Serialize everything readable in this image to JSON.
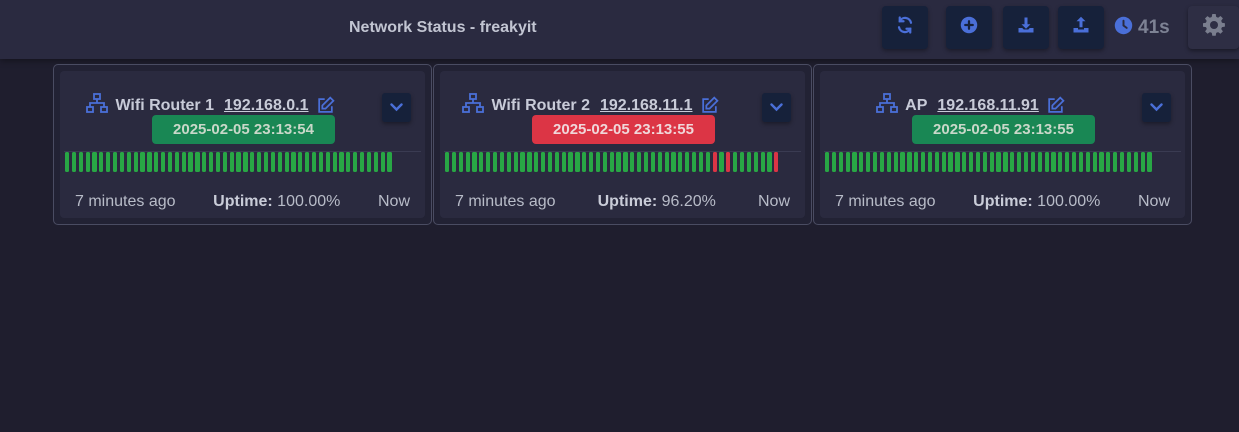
{
  "header": {
    "title": "Network Status - freakyit",
    "timer_value": "41s",
    "buttons": {
      "refresh_icon": "refresh-icon",
      "add_icon": "plus-circle-icon",
      "import_icon": "download-icon",
      "export_icon": "upload-icon",
      "timer_icon": "clock-icon",
      "settings_icon": "gear-icon"
    }
  },
  "colors": {
    "up": "#28a745",
    "down": "#dc3545",
    "accent": "#4a6fd8",
    "badge_up": "#198754",
    "badge_down": "#dc3545"
  },
  "devices": [
    {
      "name": "Wifi Router 1",
      "ip": "192.168.0.1",
      "last_check": "2025-02-05 23:13:54",
      "status": "up",
      "first_seen": "7 minutes ago",
      "uptime_label": "Uptime:",
      "uptime_value": "100.00%",
      "latest": "Now",
      "history": "gggggggggggggggggggggggggggggggggggggggggggggggg"
    },
    {
      "name": "Wifi Router 2",
      "ip": "192.168.11.1",
      "last_check": "2025-02-05 23:13:55",
      "status": "down",
      "first_seen": "7 minutes ago",
      "uptime_label": "Uptime:",
      "uptime_value": "96.20%",
      "latest": "Now",
      "history": "gggggggggggggggggggggggggggggggggggggggrgrggggggr"
    },
    {
      "name": "AP",
      "ip": "192.168.11.91",
      "last_check": "2025-02-05 23:13:55",
      "status": "up",
      "first_seen": "7 minutes ago",
      "uptime_label": "Uptime:",
      "uptime_value": "100.00%",
      "latest": "Now",
      "history": "gggggggggggggggggggggggggggggggggggggggggggggggg"
    }
  ]
}
